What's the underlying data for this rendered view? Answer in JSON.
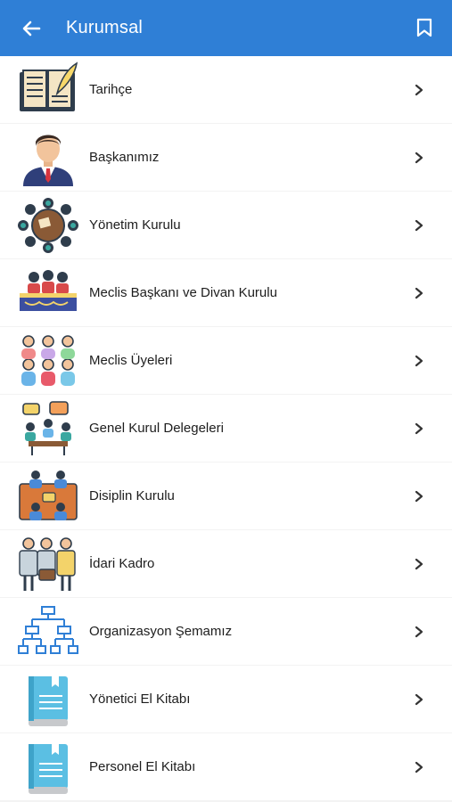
{
  "appbar": {
    "title": "Kurumsal",
    "back_icon": "arrow-left-icon",
    "bookmark_icon": "bookmark-icon",
    "color": "#2f7fd6"
  },
  "items": [
    {
      "label": "Tarihçe",
      "icon": "book-quill-icon"
    },
    {
      "label": "Başkanımız",
      "icon": "businessman-icon"
    },
    {
      "label": "Yönetim Kurulu",
      "icon": "round-table-meeting-icon"
    },
    {
      "label": "Meclis Başkanı ve Divan Kurulu",
      "icon": "council-table-icon"
    },
    {
      "label": "Meclis Üyeleri",
      "icon": "group-members-icon"
    },
    {
      "label": "Genel Kurul Delegeleri",
      "icon": "delegates-discussion-icon"
    },
    {
      "label": "Disiplin Kurulu",
      "icon": "discipline-board-icon"
    },
    {
      "label": "İdari Kadro",
      "icon": "staff-team-icon"
    },
    {
      "label": "Organizasyon Şemamız",
      "icon": "org-chart-icon"
    },
    {
      "label": "Yönetici El Kitabı",
      "icon": "handbook-icon"
    },
    {
      "label": "Personel El Kitabı",
      "icon": "handbook-icon"
    }
  ]
}
